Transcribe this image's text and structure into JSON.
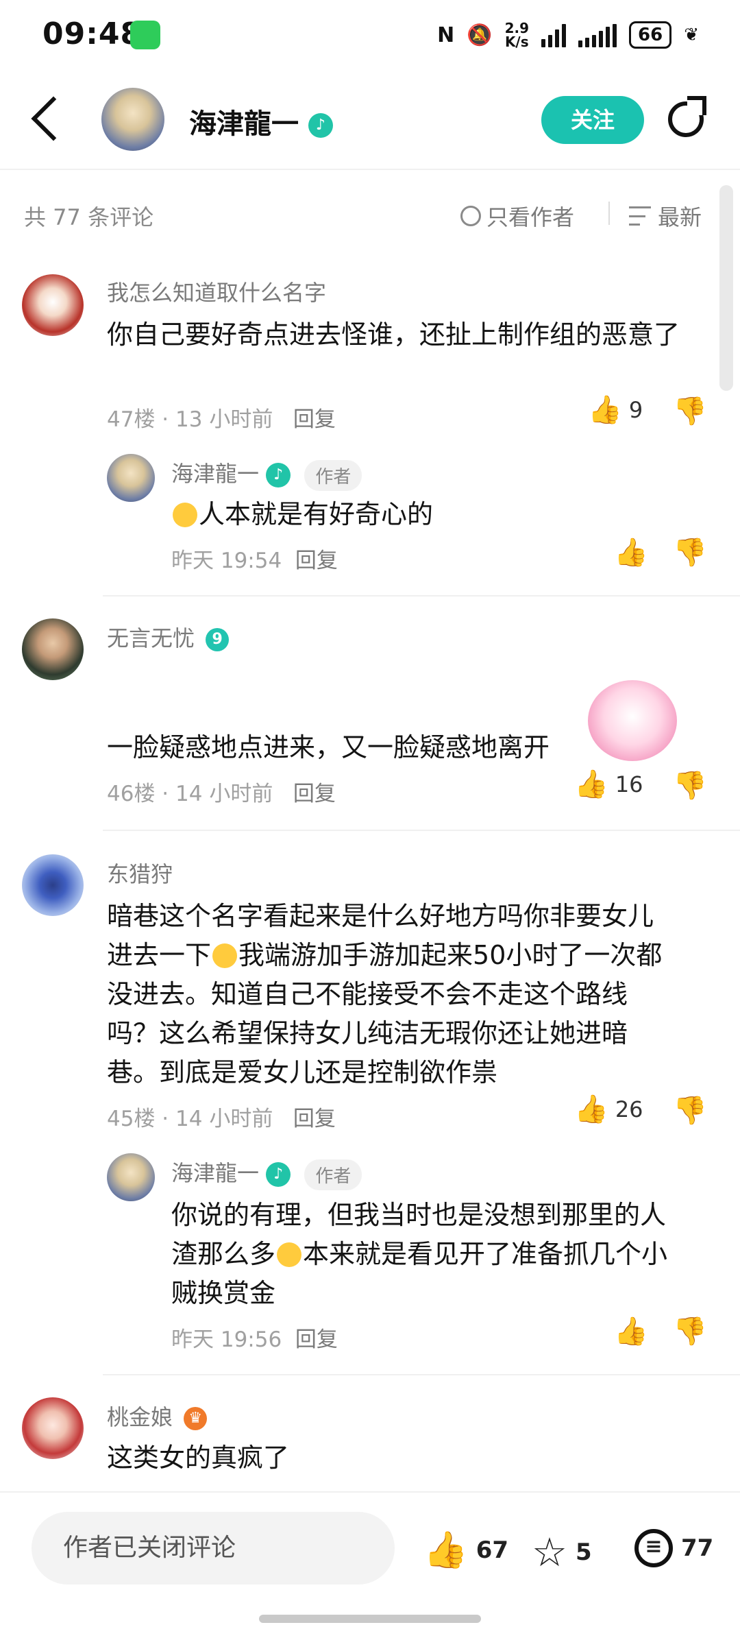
{
  "status_bar": {
    "time": "09:48",
    "net_speed_value": "2.9",
    "net_speed_unit": "K/s",
    "battery": "66",
    "nfc_icon": "nfc-icon",
    "mute_icon": "bell-off-icon"
  },
  "header": {
    "name": "海津龍一",
    "follow_label": "关注"
  },
  "sort_bar": {
    "count": "共 77 条评论",
    "only_author": "只看作者",
    "sort": "最新"
  },
  "comments": [
    {
      "user": "我怎么知道取什么名字",
      "text": "你自己要好奇点进去怪谁，还扯上制作组的恶意了",
      "floor": "47楼",
      "time": "13 小时前",
      "reply_label": "回复",
      "likes": "9",
      "reply": {
        "user": "海津龍一",
        "tag": "作者",
        "text": "人本就是有好奇心的",
        "time": "昨天 19:54",
        "reply_label": "回复"
      }
    },
    {
      "user": "无言无忧",
      "level": "9",
      "text": "一脸疑惑地点进来，又一脸疑惑地离开",
      "floor": "46楼",
      "time": "14 小时前",
      "reply_label": "回复",
      "likes": "16"
    },
    {
      "user": "东猎狩",
      "text_lines": [
        "暗巷这个名字看起来是什么好地方吗你非要女儿",
        "进去一下",
        "我端游加手游加起来50小时了一次都",
        "没进去。知道自己不能接受不会不走这个路线",
        "吗？这么希望保持女儿纯洁无瑕你还让她进暗",
        "巷。到底是爱女儿还是控制欲作祟"
      ],
      "floor": "45楼",
      "time": "14 小时前",
      "reply_label": "回复",
      "likes": "26",
      "reply": {
        "user": "海津龍一",
        "tag": "作者",
        "text_lines": [
          "你说的有理，但我当时也是没想到那里的人",
          "渣那么多",
          "本来就是看见开了准备抓几个小",
          "贼换赏金"
        ],
        "time": "昨天 19:56",
        "reply_label": "回复"
      }
    },
    {
      "user": "桃金娘",
      "text": "这类女的真疯了"
    }
  ],
  "bottom_bar": {
    "closed_label": "作者已关闭评论",
    "likes": "67",
    "favorites": "5",
    "comments": "77"
  },
  "colors": {
    "accent": "#1bc2b0",
    "verified_badge": "#21c4a8",
    "meta_gray": "#a0a0a0",
    "wechat_green": "#2ecc5a"
  }
}
